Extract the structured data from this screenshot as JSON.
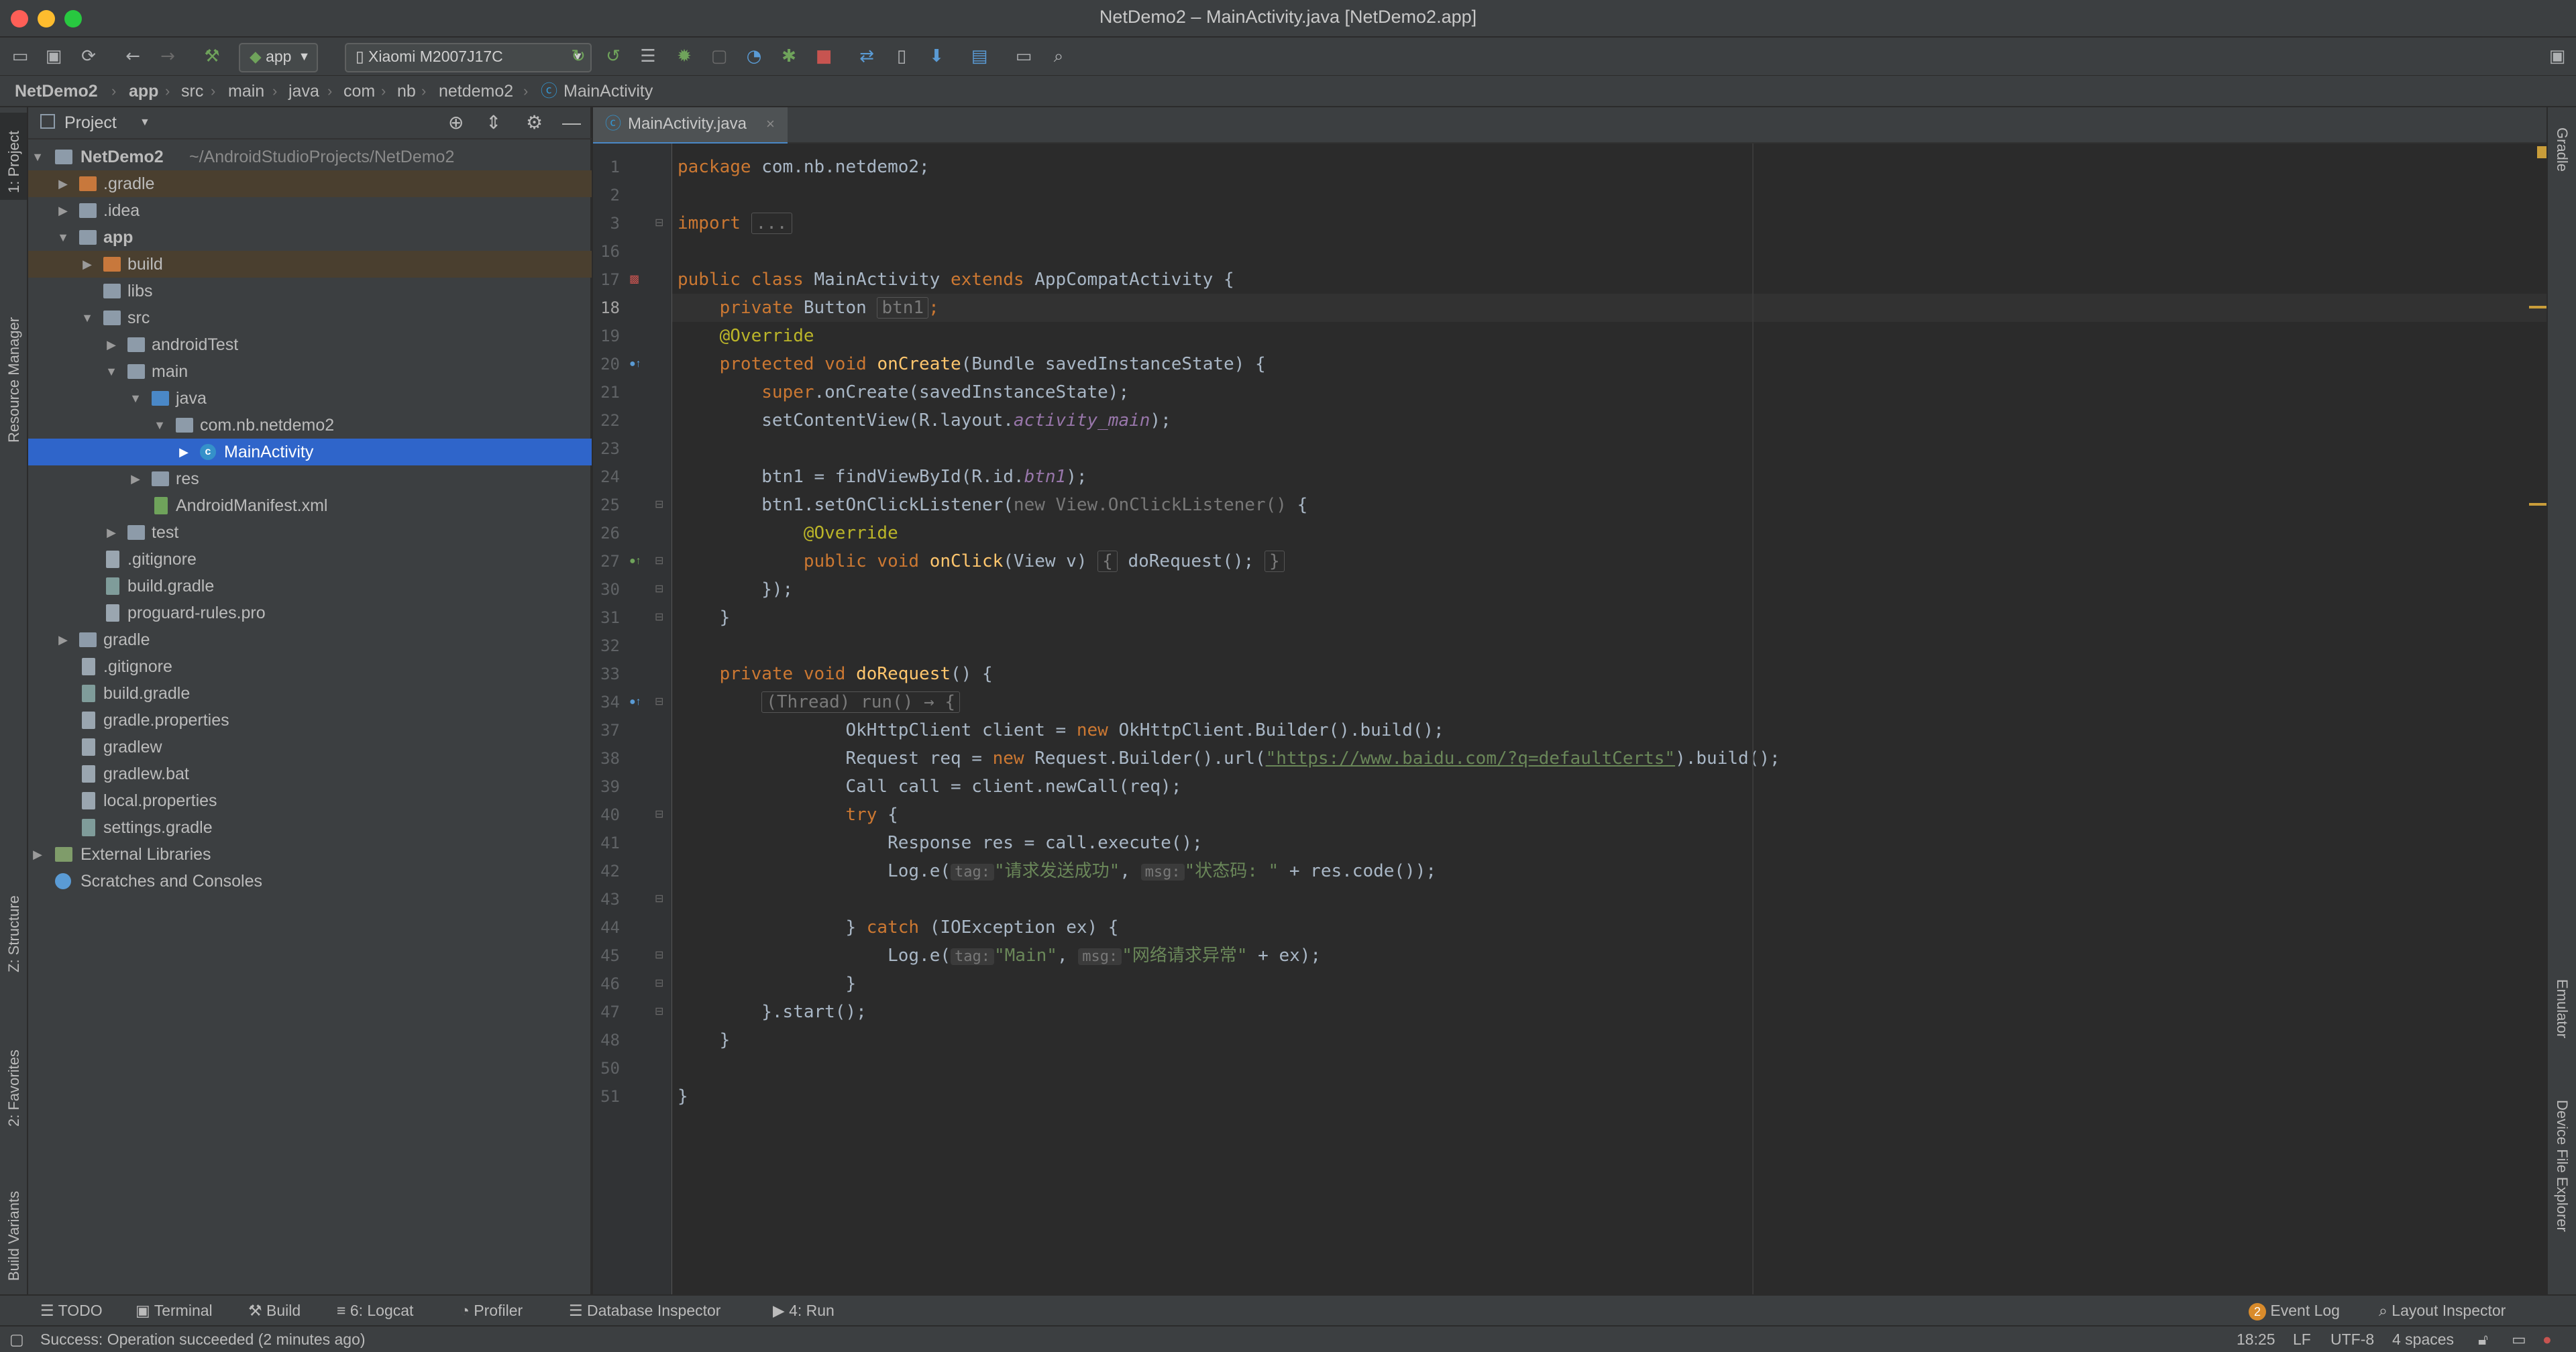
{
  "window": {
    "title": "NetDemo2 – MainActivity.java [NetDemo2.app]"
  },
  "toolbar": {
    "run_config": "app",
    "device": "Xiaomi M2007J17C",
    "icons": [
      "open-folder-icon",
      "save-icon",
      "sync-icon",
      "back-icon",
      "forward-icon",
      "build-hammer-icon",
      "run-icon",
      "apply-changes-icon",
      "apply-code-changes-icon",
      "debug-icon",
      "attach-debugger-icon",
      "profile-icon",
      "debug-bug-icon",
      "stop-icon",
      "sync-gradle-icon",
      "avd-manager-icon",
      "sdk-manager-icon",
      "project-structure-icon",
      "layout-icon",
      "search-icon"
    ]
  },
  "breadcrumb": [
    "NetDemo2",
    "app",
    "src",
    "main",
    "java",
    "com",
    "nb",
    "netdemo2",
    "MainActivity"
  ],
  "left_strip": {
    "project": "1: Project",
    "resource_manager": "Resource Manager",
    "structure": "Z: Structure",
    "favorites": "2: Favorites",
    "build_variants": "Build Variants"
  },
  "right_strip": {
    "gradle": "Gradle",
    "emulator": "Emulator",
    "device_file_explorer": "Device File Explorer"
  },
  "project": {
    "header": "Project",
    "tree": [
      {
        "label": "NetDemo2",
        "hint": "~/AndroidStudioProjects/NetDemo2"
      },
      {
        "label": ".gradle"
      },
      {
        "label": ".idea"
      },
      {
        "label": "app"
      },
      {
        "label": "build"
      },
      {
        "label": "libs"
      },
      {
        "label": "src"
      },
      {
        "label": "androidTest"
      },
      {
        "label": "main"
      },
      {
        "label": "java"
      },
      {
        "label": "com.nb.netdemo2"
      },
      {
        "label": "MainActivity"
      },
      {
        "label": "res"
      },
      {
        "label": "AndroidManifest.xml"
      },
      {
        "label": "test"
      },
      {
        "label": ".gitignore"
      },
      {
        "label": "build.gradle"
      },
      {
        "label": "proguard-rules.pro"
      },
      {
        "label": "gradle"
      },
      {
        "label": ".gitignore"
      },
      {
        "label": "build.gradle"
      },
      {
        "label": "gradle.properties"
      },
      {
        "label": "gradlew"
      },
      {
        "label": "gradlew.bat"
      },
      {
        "label": "local.properties"
      },
      {
        "label": "settings.gradle"
      },
      {
        "label": "External Libraries"
      },
      {
        "label": "Scratches and Consoles"
      }
    ]
  },
  "editor": {
    "tab": "MainActivity.java",
    "line_numbers": [
      "1",
      "2",
      "3",
      "16",
      "17",
      "18",
      "19",
      "20",
      "21",
      "22",
      "23",
      "24",
      "25",
      "26",
      "27",
      "30",
      "31",
      "32",
      "33",
      "34",
      "37",
      "38",
      "39",
      "40",
      "41",
      "42",
      "43",
      "44",
      "45",
      "46",
      "47",
      "48",
      "50",
      "51"
    ],
    "code": {
      "l1_kw": "package",
      "l1_rest": " com.nb.netdemo2;",
      "l3_kw": "import",
      "l3_fold": "...",
      "l17_a": "public class",
      "l17_b": " MainActivity ",
      "l17_c": "extends",
      "l17_d": " AppCompatActivity {",
      "l18_a": "private",
      "l18_b": " Button ",
      "l18_c": "btn1",
      "l18_d": ";",
      "l19": "@Override",
      "l20_a": "protected void",
      "l20_b": "onCreate",
      "l20_c": "(Bundle savedInstanceState) {",
      "l21_a": "super",
      "l21_b": ".onCreate(savedInstanceState);",
      "l22_a": "setContentView(R.layout.",
      "l22_b": "activity_main",
      "l22_c": ");",
      "l24_a": "btn1 = findViewById(R.id.",
      "l24_b": "btn1",
      "l24_c": ");",
      "l25_a": "btn1.setOnClickListener(",
      "l25_b": "new View.OnClickListener()",
      "l25_c": " {",
      "l26": "@Override",
      "l27_a": "public void",
      "l27_b": "onClick",
      "l27_c": "(View v) ",
      "l27_d": "{",
      "l27_e": " doRequest(); ",
      "l27_f": "}",
      "l30": "});",
      "l31": "}",
      "l33_a": "private void",
      "l33_b": "doRequest",
      "l33_c": "() {",
      "l34_a": "(Thread) run() → {",
      "l37_a": "OkHttpClient client = ",
      "l37_b": "new",
      "l37_c": " OkHttpClient.Builder().build();",
      "l38_a": "Request req = ",
      "l38_b": "new",
      "l38_c": " Request.Builder().url(",
      "l38_d": "\"https://www.baidu.com/?q=defaultCerts\"",
      "l38_e": ").build();",
      "l39": "Call call = client.newCall(req);",
      "l40_a": "try",
      "l40_b": " {",
      "l41": "Response res = call.execute();",
      "l42_a": "Log.e(",
      "l42_b": "tag:",
      "l42_c": "\"请求发送成功\"",
      "l42_d": ", ",
      "l42_e": "msg:",
      "l42_f": "\"状态码: \"",
      "l42_g": " + res.code());",
      "l44_a": "} ",
      "l44_b": "catch",
      "l44_c": " (IOException ex) {",
      "l45_a": "Log.e(",
      "l45_b": "tag:",
      "l45_c": "\"Main\"",
      "l45_d": ", ",
      "l45_e": "msg:",
      "l45_f": "\"网络请求异常\"",
      "l45_g": " + ex);",
      "l46": "}",
      "l47": "}.start();",
      "l48": "}",
      "l51": "}"
    }
  },
  "bottom_tools": {
    "todo": "TODO",
    "terminal": "Terminal",
    "build": "Build",
    "logcat": "6: Logcat",
    "profiler": "Profiler",
    "database_inspector": "Database Inspector",
    "run": "4: Run",
    "event_log": "Event Log",
    "event_log_count": "2",
    "layout_inspector": "Layout Inspector"
  },
  "status": {
    "message": "Success: Operation succeeded (2 minutes ago)",
    "position": "18:25",
    "line_sep": "LF",
    "encoding": "UTF-8",
    "indent": "4 spaces"
  },
  "colors": {
    "selection": "#2f65ca",
    "keyword": "#cc7832",
    "string": "#6a8759",
    "annotation": "#bbb529",
    "method": "#ffc66d",
    "field": "#9876aa"
  }
}
